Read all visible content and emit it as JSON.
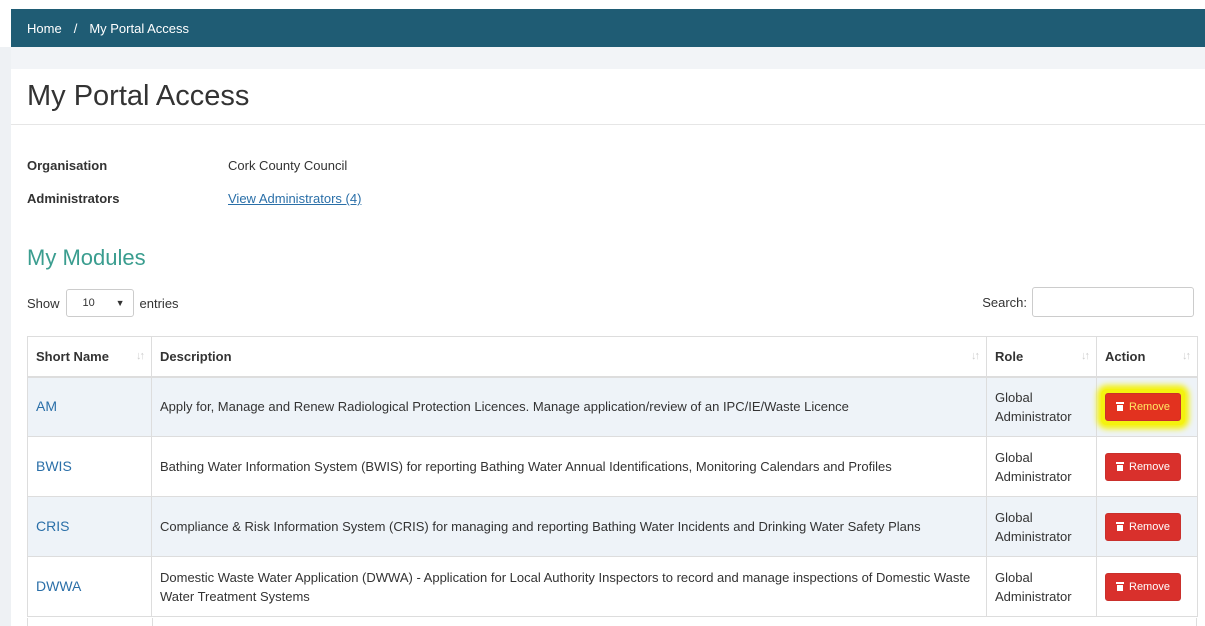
{
  "breadcrumb": {
    "home": "Home",
    "separator": "/",
    "current": "My Portal Access"
  },
  "page": {
    "title": "My Portal Access"
  },
  "info": {
    "organisation_label": "Organisation",
    "organisation_value": "Cork County Council",
    "administrators_label": "Administrators",
    "administrators_link": "View Administrators (4)"
  },
  "modules": {
    "title": "My Modules",
    "show_label": "Show",
    "entries_label": "entries",
    "page_length": "10",
    "search_label": "Search:",
    "search_value": "",
    "columns": [
      "Short Name",
      "Description",
      "Role",
      "Action"
    ],
    "rows": [
      {
        "short": "AM",
        "description": "Apply for, Manage and Renew Radiological Protection Licences. Manage application/review of an IPC/IE/Waste Licence",
        "role": "Global Administrator",
        "action": "Remove",
        "highlighted": true
      },
      {
        "short": "BWIS",
        "description": "Bathing Water Information System (BWIS) for reporting Bathing Water Annual Identifications, Monitoring Calendars and Profiles",
        "role": "Global Administrator",
        "action": "Remove"
      },
      {
        "short": "CRIS",
        "description": "Compliance & Risk Information System (CRIS) for managing and reporting Bathing Water Incidents and Drinking Water Safety Plans",
        "role": "Global Administrator",
        "action": "Remove"
      },
      {
        "short": "DWWA",
        "description": "Domestic Waste Water Application (DWWA) - Application for Local Authority Inspectors to record and manage inspections of Domestic Waste Water Treatment Systems",
        "role": "Global Administrator",
        "action": "Remove"
      }
    ]
  },
  "icons": {
    "sort": "sort-icon",
    "trash": "trash-icon",
    "caret": "caret-down-icon"
  },
  "colors": {
    "nav": "#1f5c74",
    "accent": "#3a9d8f",
    "link": "#2a6fa8",
    "danger": "#d9302c",
    "highlight": "#f4f20f"
  }
}
